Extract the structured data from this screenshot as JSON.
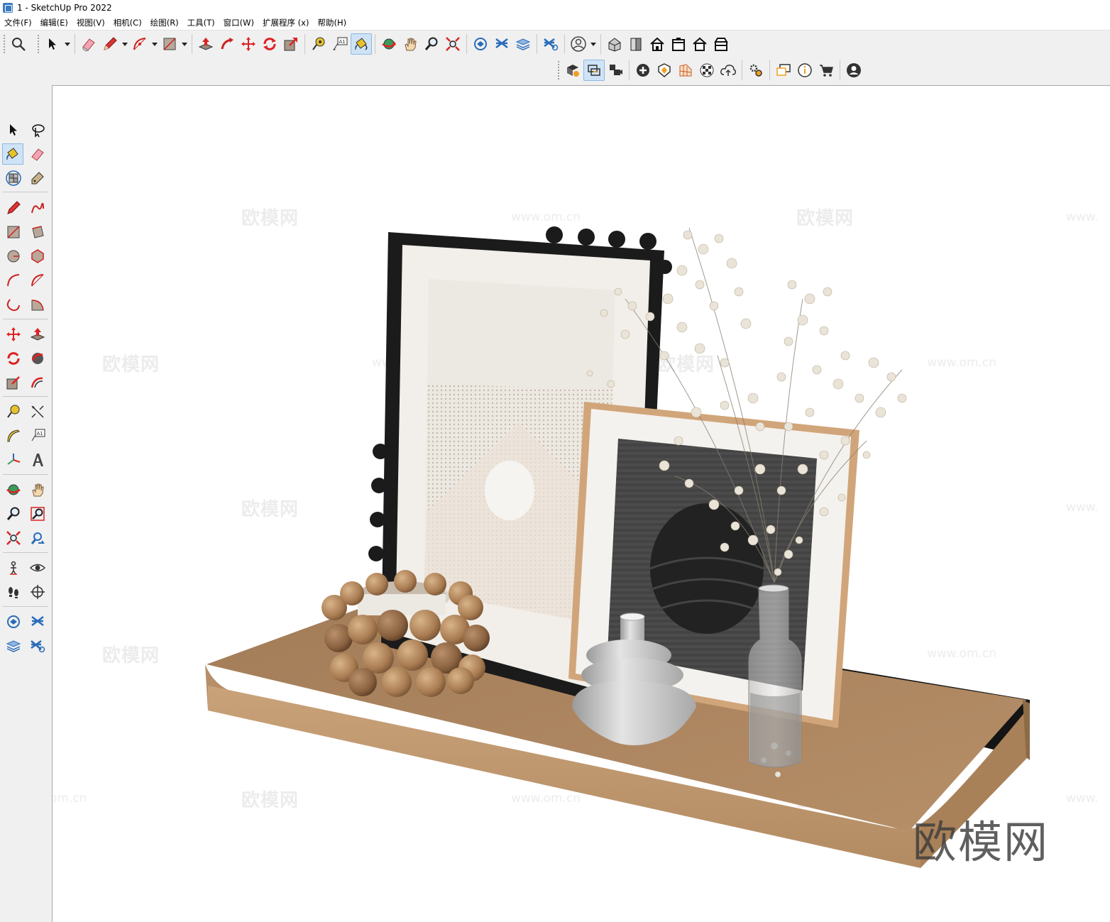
{
  "window": {
    "title": "1 - SketchUp Pro 2022"
  },
  "menu": [
    "文件(F)",
    "编辑(E)",
    "视图(V)",
    "相机(C)",
    "绘图(R)",
    "工具(T)",
    "窗口(W)",
    "扩展程序 (x)",
    "帮助(H)"
  ],
  "toolbar": {
    "text_tool_label": "A1"
  },
  "palette": {
    "text_tool_label": "A1"
  },
  "watermarks": {
    "site_cn": "欧模网",
    "site_url": "www.om.cn",
    "url_fragment": "om.cn",
    "url_fragment_right": "www."
  },
  "brand_watermark": "欧模网",
  "colors": {
    "wood": "#b08962",
    "frame_black": "#1a1a1a",
    "selection": "#cfe3f7"
  }
}
